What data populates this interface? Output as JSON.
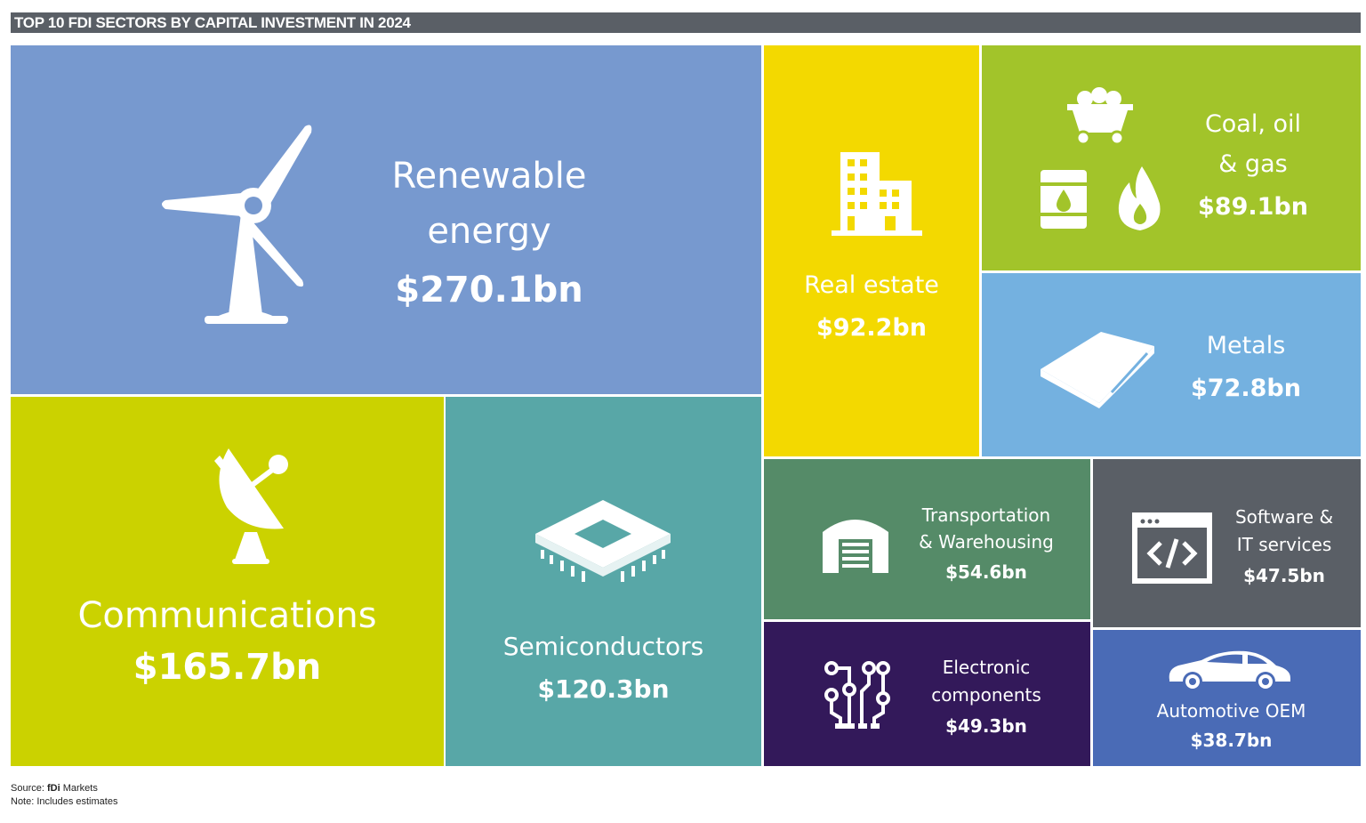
{
  "title": "TOP 10 FDI SECTORS BY CAPITAL INVESTMENT IN 2024",
  "chart_data": {
    "type": "treemap",
    "title": "TOP 10 FDI SECTORS BY CAPITAL INVESTMENT IN 2024",
    "unit": "$bn",
    "categories": [
      "Renewable energy",
      "Communications",
      "Semiconductors",
      "Real estate",
      "Coal, oil & gas",
      "Metals",
      "Transportation & Warehousing",
      "Electronic components",
      "Software & IT services",
      "Automotive OEM"
    ],
    "values": [
      270.1,
      165.7,
      120.3,
      92.2,
      89.1,
      72.8,
      54.6,
      49.3,
      47.5,
      38.7
    ],
    "colors": [
      "#7799cf",
      "#cbd200",
      "#58a7a7",
      "#f3d900",
      "#a2c42a",
      "#74b1e0",
      "#558b68",
      "#33195a",
      "#5a5f66",
      "#4a6bb6"
    ]
  },
  "tiles": {
    "renewable": {
      "name1": "Renewable",
      "name2": "energy",
      "value": "$270.1bn",
      "icon": "wind-turbine-icon"
    },
    "communications": {
      "name": "Communications",
      "value": "$165.7bn",
      "icon": "satellite-dish-icon"
    },
    "semiconductors": {
      "name": "Semiconductors",
      "value": "$120.3bn",
      "icon": "microchip-icon"
    },
    "realestate": {
      "name": "Real estate",
      "value": "$92.2bn",
      "icon": "building-icon"
    },
    "coal": {
      "name1": "Coal, oil",
      "name2": "& gas",
      "value": "$89.1bn",
      "icon": "mine-cart-barrel-flame-icon"
    },
    "metals": {
      "name": "Metals",
      "value": "$72.8bn",
      "icon": "metal-sheets-icon"
    },
    "transport": {
      "name1": "Transportation",
      "name2": "& Warehousing",
      "value": "$54.6bn",
      "icon": "warehouse-icon"
    },
    "software": {
      "name1": "Software &",
      "name2": "IT services",
      "value": "$47.5bn",
      "icon": "code-window-icon"
    },
    "electronic": {
      "name1": "Electronic",
      "name2": "components",
      "value": "$49.3bn",
      "icon": "circuit-icon"
    },
    "automotive": {
      "name": "Automotive OEM",
      "value": "$38.7bn",
      "icon": "car-icon"
    }
  },
  "footer": {
    "source_prefix": "Source: ",
    "source_brand": "fDi",
    "source_suffix": " Markets",
    "note": "Note: Includes estimates"
  }
}
